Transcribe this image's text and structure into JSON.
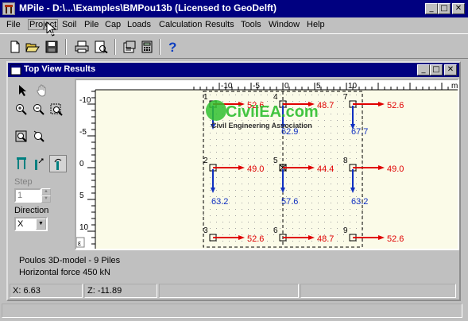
{
  "app": {
    "title": "MPile - D:\\...\\Examples\\BMPou13b (Licensed to GeoDelft)"
  },
  "window_controls": {
    "minimize": "_",
    "maximize": "□",
    "close": "✕"
  },
  "menu": [
    {
      "label": "File"
    },
    {
      "label": "Project"
    },
    {
      "label": "Soil"
    },
    {
      "label": "Pile"
    },
    {
      "label": "Cap"
    },
    {
      "label": "Loads"
    },
    {
      "label": "Calculation"
    },
    {
      "label": "Results"
    },
    {
      "label": "Tools"
    },
    {
      "label": "Window"
    },
    {
      "label": "Help"
    }
  ],
  "toolbar": [
    "new-icon",
    "open-icon",
    "save-icon",
    "print-icon",
    "print-preview-icon",
    "properties-icon",
    "calculator-icon",
    "help-icon"
  ],
  "child": {
    "title": "Top View Results"
  },
  "tools": {
    "step_label": "Step",
    "step_value": "1",
    "direction_label": "Direction",
    "direction_value": "X"
  },
  "ruler": {
    "top": [
      "-10",
      "-5",
      "0",
      "5",
      "10"
    ],
    "top_unit": "m",
    "left": [
      "-10",
      "-5",
      "0",
      "5",
      "10"
    ],
    "corner": "ε"
  },
  "piles": [
    {
      "id": "1",
      "force": "52.6",
      "moment": ""
    },
    {
      "id": "4",
      "force": "48.7",
      "moment": "62.9"
    },
    {
      "id": "7",
      "force": "52.6",
      "moment": "67.7"
    },
    {
      "id": "2",
      "force": "49.0",
      "moment": "63.2"
    },
    {
      "id": "5",
      "force": "44.4",
      "moment": "57.6"
    },
    {
      "id": "8",
      "force": "49.0",
      "moment": "63.2"
    },
    {
      "id": "3",
      "force": "52.6",
      "moment": ""
    },
    {
      "id": "6",
      "force": "48.7",
      "moment": ""
    },
    {
      "id": "9",
      "force": "52.6",
      "moment": ""
    }
  ],
  "watermark": {
    "text": "CivilEA.com",
    "subtitle": "Civil Engineering Association"
  },
  "info": {
    "line1": "Poulos 3D-model - 9 Piles",
    "line2": "Horizontal force 450 kN"
  },
  "status": {
    "x": "X: 6.63",
    "z": "Z: -11.89"
  },
  "colors": {
    "title_bar": "#000080",
    "force_arrow": "#e00000",
    "moment_arrow": "#1030c0",
    "canvas": "#fbfbe8"
  }
}
